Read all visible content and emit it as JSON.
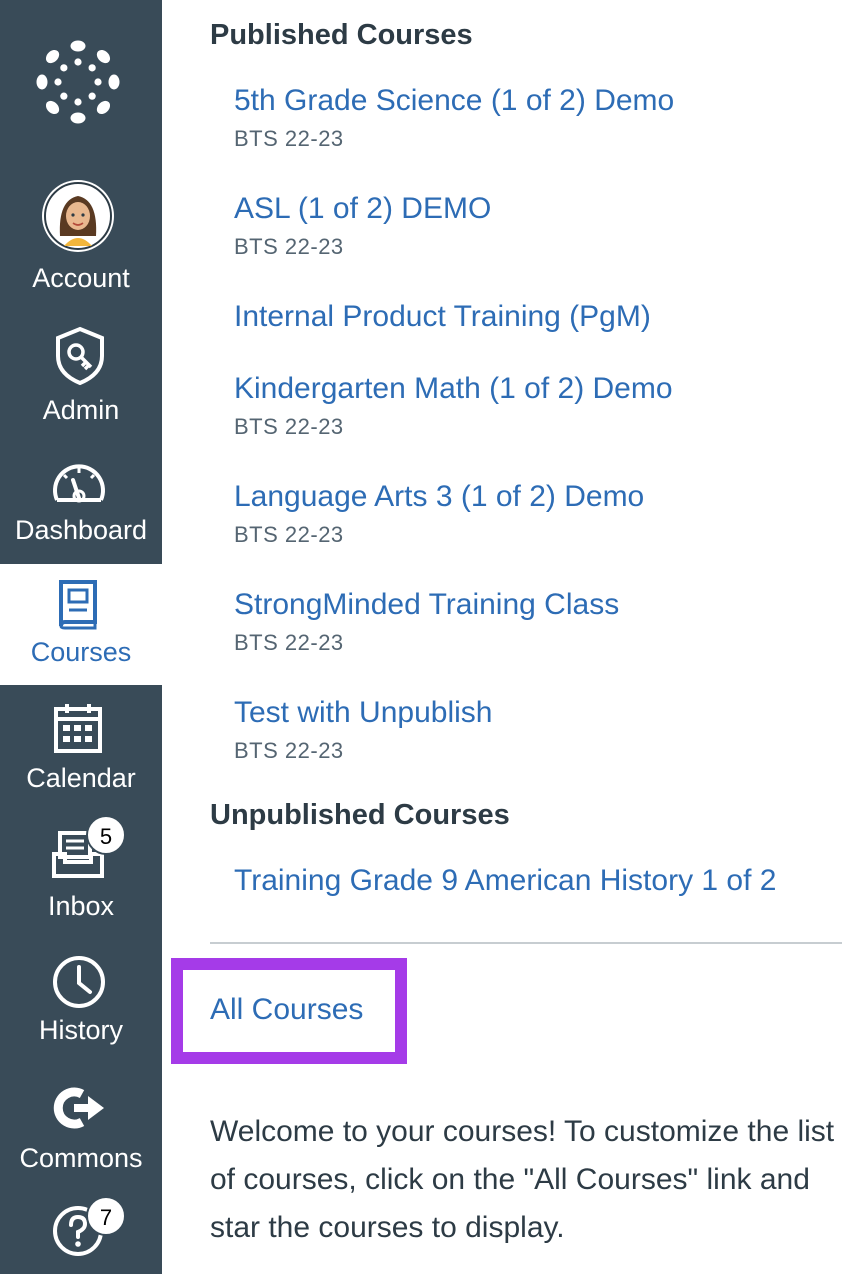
{
  "nav": {
    "account_label": "Account",
    "admin_label": "Admin",
    "dashboard_label": "Dashboard",
    "courses_label": "Courses",
    "calendar_label": "Calendar",
    "inbox_label": "Inbox",
    "inbox_badge": "5",
    "history_label": "History",
    "commons_label": "Commons",
    "help_badge": "7"
  },
  "tray": {
    "published_title": "Published Courses",
    "published": [
      {
        "name": "5th Grade Science (1 of 2) Demo",
        "term": "BTS 22-23"
      },
      {
        "name": "ASL (1 of 2) DEMO",
        "term": "BTS 22-23"
      },
      {
        "name": "Internal Product Training (PgM)",
        "term": ""
      },
      {
        "name": "Kindergarten Math (1 of 2) Demo",
        "term": "BTS 22-23"
      },
      {
        "name": "Language Arts 3 (1 of 2) Demo",
        "term": "BTS 22-23"
      },
      {
        "name": "StrongMinded Training Class",
        "term": "BTS 22-23"
      },
      {
        "name": "Test with Unpublish",
        "term": "BTS 22-23"
      }
    ],
    "unpublished_title": "Unpublished Courses",
    "unpublished": [
      {
        "name": "Training Grade 9 American History 1 of 2"
      }
    ],
    "all_courses_label": "All Courses",
    "welcome_text": "Welcome to your courses! To customize the list of courses, click on the \"All Courses\" link and star the courses to display."
  },
  "colors": {
    "nav_bg": "#394B58",
    "link": "#2D6CB5",
    "highlight": "#A53BE8"
  }
}
